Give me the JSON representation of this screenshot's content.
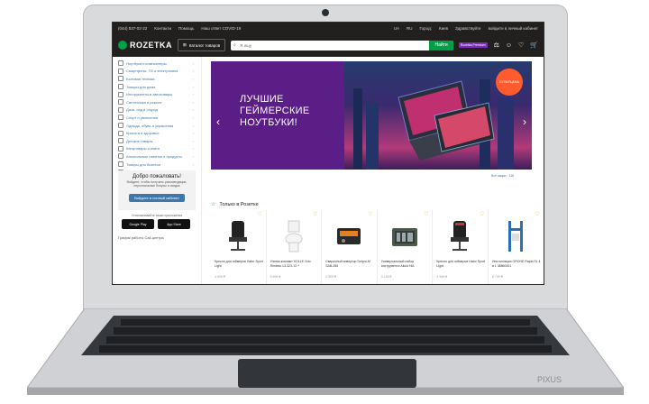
{
  "topbar": {
    "phone": "(044) 537-02-22",
    "links": [
      "Контакти",
      "Помощь",
      "Наш ответ COVID-19"
    ],
    "lang_ua": "UA",
    "lang_ru": "RU",
    "city_label": "Город:",
    "city": "Киев",
    "cashback": "Здравствуйте",
    "login": "войдите в личный кабинет"
  },
  "header": {
    "logo": "ROZETKA",
    "catalog": "Каталог товаров",
    "search_placeholder": "Я ищу",
    "search_button": "Найти",
    "premium_label": "Rozetka Premium"
  },
  "sidebar": {
    "items": [
      "Ноутбуки и компьютеры",
      "Смартфоны, ТВ и электроника",
      "Бытовая техника",
      "Товары для дома",
      "Инструменты и автотовары",
      "Сантехника и ремонт",
      "Дача, сад и огород",
      "Спорт и увлечения",
      "Одежда, обувь и украшения",
      "Красота и здоровье",
      "Детские товары",
      "Канцтовары и книги",
      "Алкогольные напитки и продукты",
      "Товары для бизнеса",
      "Услуги и сервисы",
      "Суперскидки до 60%",
      "Туры и отдых"
    ],
    "welcome_title": "Добро пожаловать!",
    "welcome_text": "Войдите, чтобы получать рекомендации, персональные бонусы и скидки",
    "welcome_button": "Войдите в личный кабинет",
    "app_label": "Устанавливайте наши приложения",
    "google_play": "Google Play",
    "app_store": "App Store",
    "call_center": "График работы Call-центра"
  },
  "banner": {
    "line1": "ЛУЧШИЕ",
    "line2": "ГЕЙМЕРСКИЕ",
    "line3": "НОУТБУКИ!",
    "badge": "СУПЕРЦЕНА",
    "all_promos": "Все акции · 116"
  },
  "section": {
    "title": "Только в Розетке"
  },
  "products": [
    {
      "name": "Кресло для геймеров Hator Sport Light",
      "price": "4 999 ₴"
    },
    {
      "name": "Унитаз-компакт VOLLE Orlo Rimless 13-323-13 +",
      "price": "5 699 ₴"
    },
    {
      "name": "Сварочный инвертор Dnipro-M SAB-255",
      "price": "2 599 ₴"
    },
    {
      "name": "Универсальный набор инструмента Alloid НИ-",
      "price": "3 199 ₴"
    },
    {
      "name": "Кресло для геймеров Hator Sport Light",
      "price": "4 999 ₴"
    },
    {
      "name": "Инсталляция GROHE Rapid SL 4 в 1 38860001",
      "price": "6 799 ₴"
    }
  ],
  "laptop": {
    "brand": "PIXUS"
  }
}
